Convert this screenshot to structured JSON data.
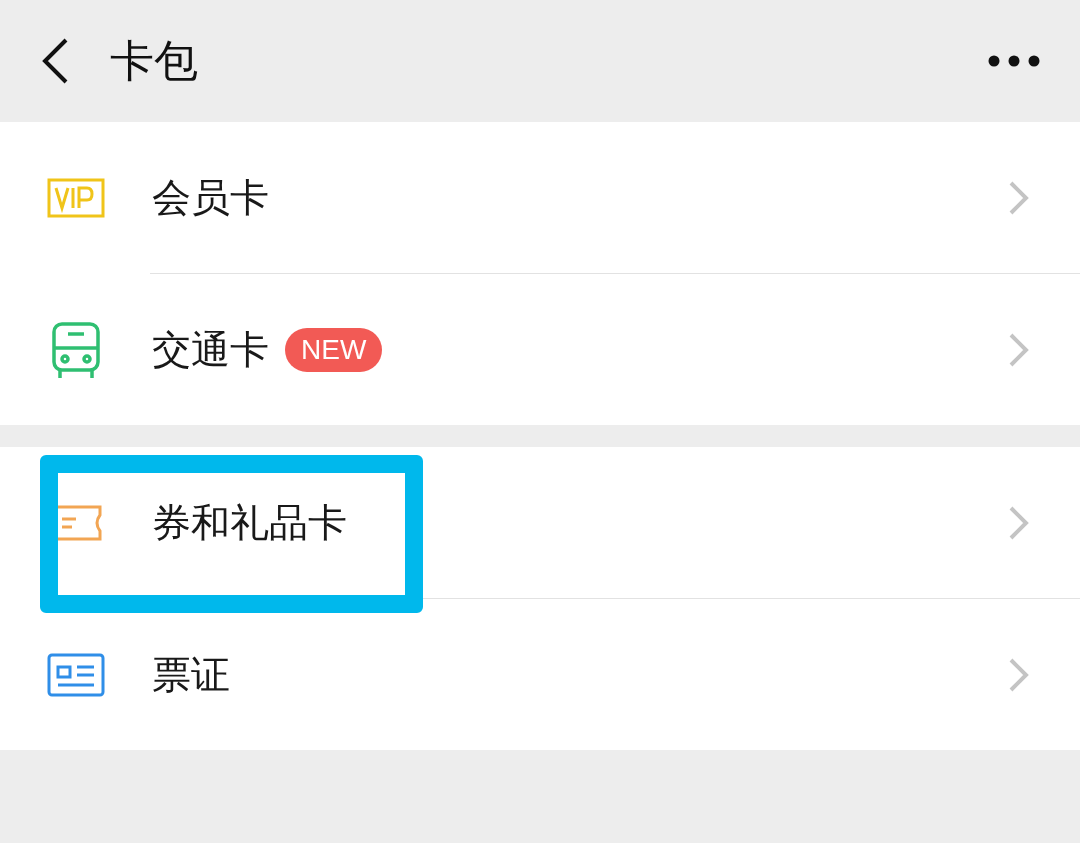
{
  "header": {
    "title": "卡包"
  },
  "groups": [
    {
      "items": [
        {
          "kind": "vip",
          "label": "会员卡",
          "highlighted": false
        },
        {
          "kind": "bus",
          "label": "交通卡",
          "badge": "NEW",
          "highlighted": false
        }
      ]
    },
    {
      "items": [
        {
          "kind": "ticket",
          "label": "券和礼品卡",
          "highlighted": true
        },
        {
          "kind": "id",
          "label": "票证",
          "highlighted": false
        }
      ]
    }
  ]
}
